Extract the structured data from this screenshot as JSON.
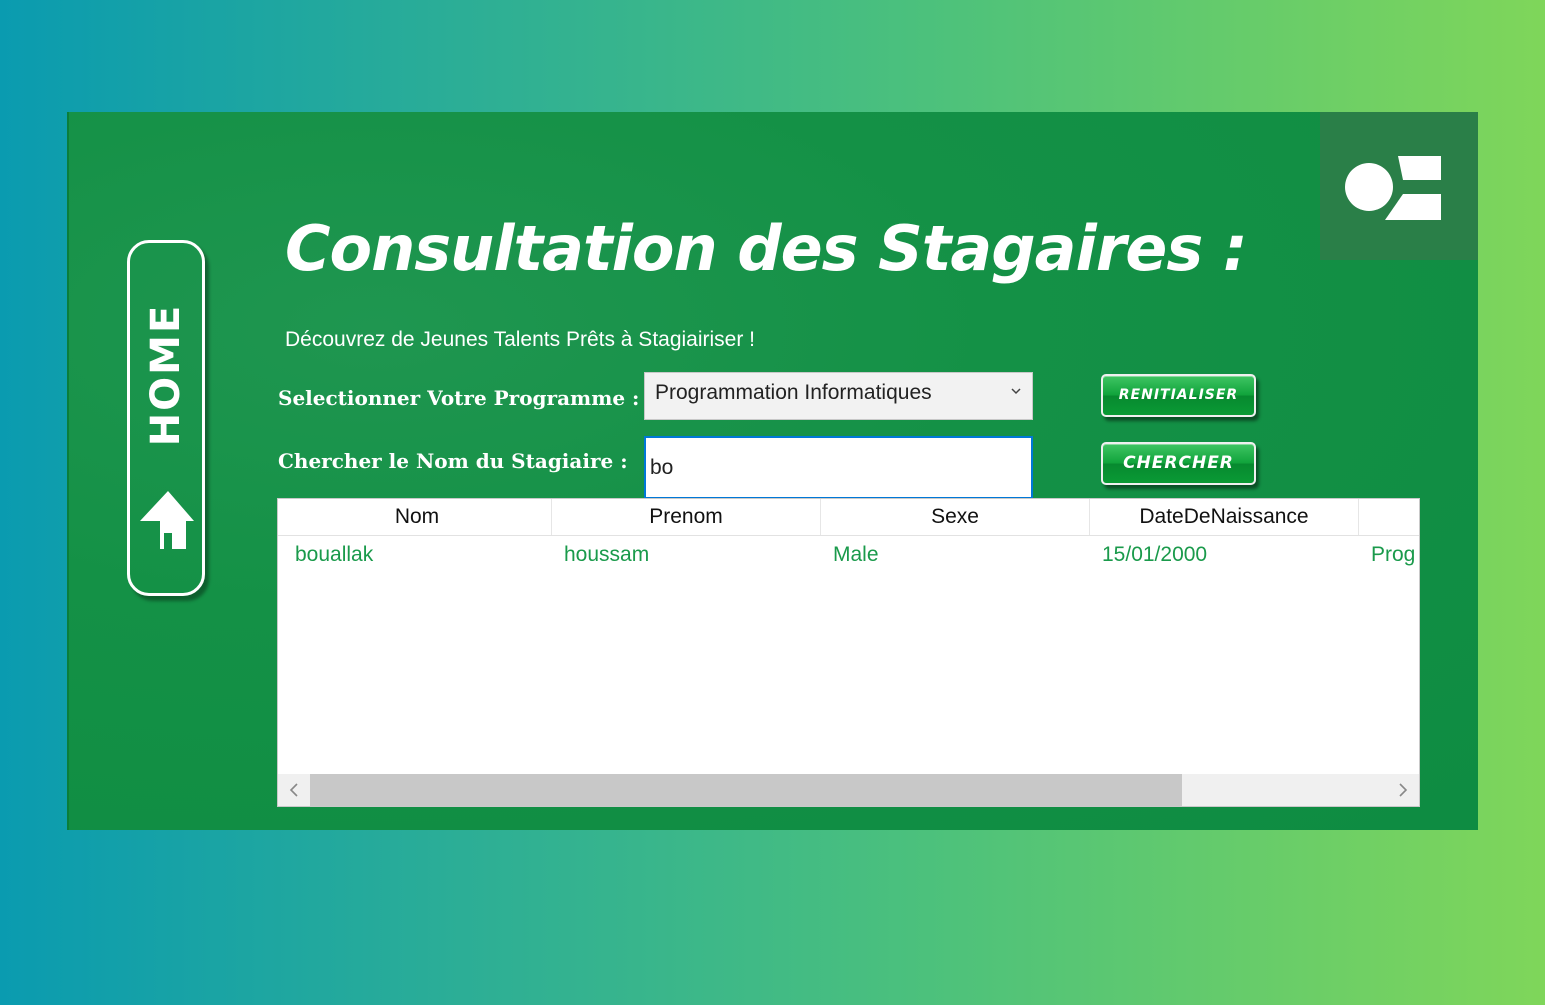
{
  "page": {
    "title": "Consultation des Stagaires :",
    "subtitle": "Découvrez de Jeunes Talents Prêts à Stagiairiser !"
  },
  "home_button": {
    "label": "HOME"
  },
  "form": {
    "program_label": "Selectionner Votre Programme :",
    "program_selected": "Programmation Informatiques",
    "search_label": "Chercher le Nom du Stagiaire :",
    "search_value": "bo"
  },
  "buttons": {
    "reset_label": "RENITIALISER",
    "search_label": "CHERCHER"
  },
  "table": {
    "columns": [
      "Nom",
      "Prenom",
      "Sexe",
      "DateDeNaissance",
      ""
    ],
    "rows": [
      [
        "bouallak",
        "houssam",
        "Male",
        "15/01/2000",
        "Prog"
      ]
    ],
    "scroll_fraction": 0.81
  },
  "colors": {
    "background_start": "#0a9bb0",
    "background_end": "#7fd65a",
    "window": "#0e8c42",
    "logo_box": "#2a7f48",
    "cell_text": "#1a9a4b",
    "focus_border": "#0078d7"
  },
  "icons": {
    "home": "home-arrow-icon",
    "logo": "ofppt-logo-icon",
    "dropdown": "chevron-down-icon",
    "scroll_left": "chevron-left-icon",
    "scroll_right": "chevron-right-icon"
  }
}
